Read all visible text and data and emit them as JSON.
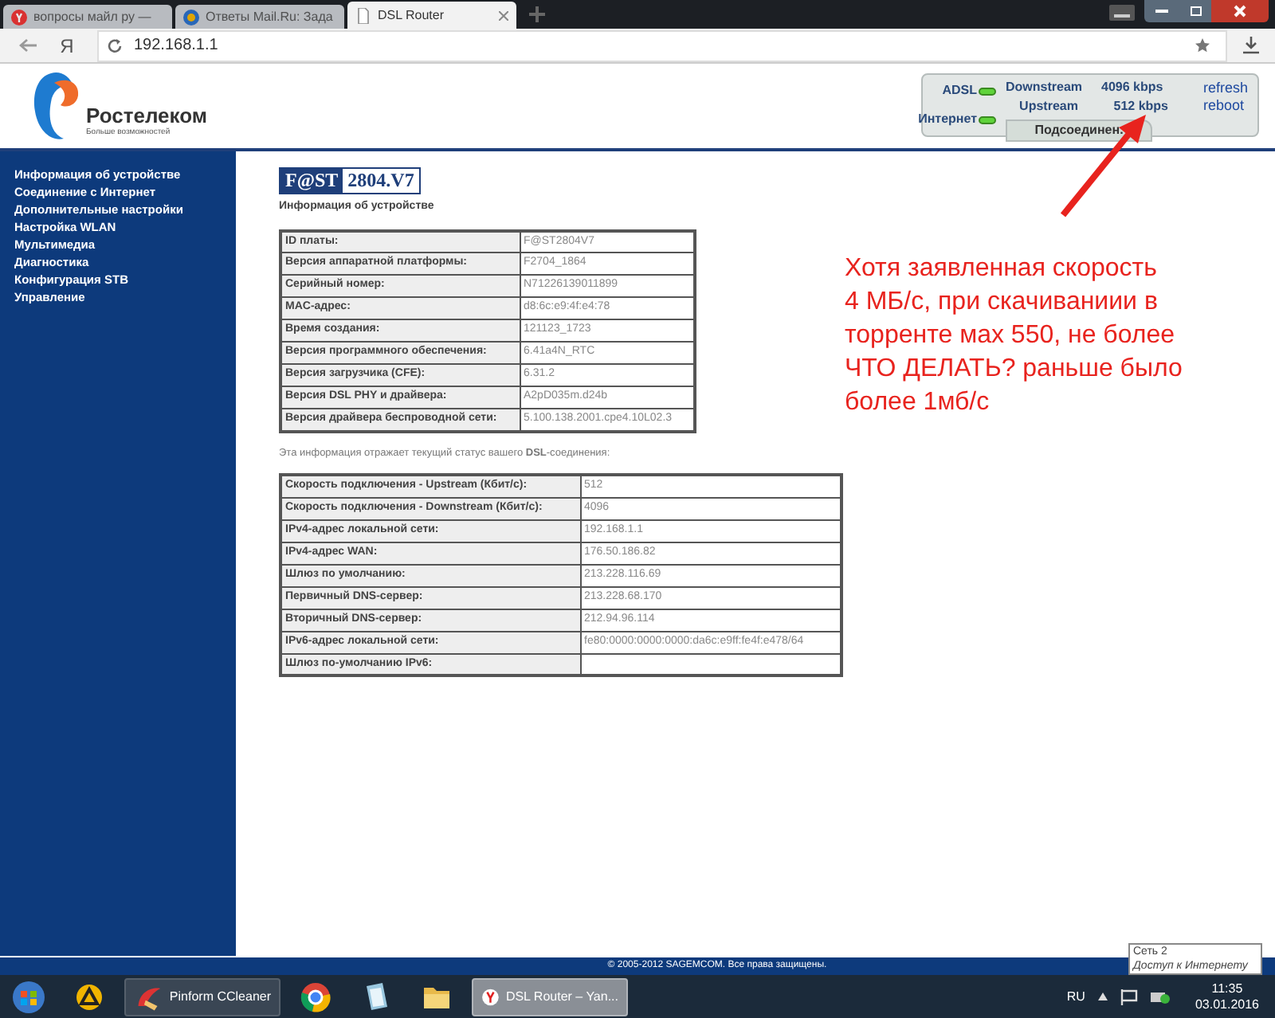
{
  "browser": {
    "tabs": [
      {
        "label": "вопросы майл ру —",
        "selected": false,
        "kind": "yandex"
      },
      {
        "label": "Ответы Mail.Ru: Зада",
        "selected": false,
        "kind": "mail"
      },
      {
        "label": "DSL Router",
        "selected": true,
        "kind": "page"
      }
    ],
    "address_bar": {
      "yandex_button": "Я",
      "url": "192.168.1.1"
    }
  },
  "header": {
    "logo": {
      "name": "Ростелеком",
      "slogan": "Больше возможностей"
    },
    "status": {
      "leds": [
        {
          "label": "ADSL",
          "on": true
        },
        {
          "label": "Интернет",
          "on": true
        }
      ],
      "downstream": {
        "label": "Downstream",
        "value": "4096 kbps"
      },
      "upstream": {
        "label": "Upstream",
        "value": "512 kbps"
      },
      "connection": "Подсоединен.",
      "links": [
        "refresh",
        "reboot"
      ]
    }
  },
  "sidebar": {
    "items": [
      "Информация об устройстве",
      "Соединение с Интернет",
      "Дополнительные настройки",
      "Настройка WLAN",
      "Мультимедиа",
      "Диагностика",
      "Конфигурация STB",
      "Управление"
    ]
  },
  "content": {
    "model": {
      "brand": "F@ST",
      "number": "2804.V7"
    },
    "subtitle": "Информация об устройстве",
    "device_table": [
      [
        "ID платы:",
        "F@ST2804V7"
      ],
      [
        "Версия аппаратной платформы:",
        "F2704_1864"
      ],
      [
        "Серийный номер:",
        "N71226139011899"
      ],
      [
        "MAC-адрес:",
        "d8:6c:e9:4f:e4:78"
      ],
      [
        "Время создания:",
        "121123_1723"
      ],
      [
        "Версия программного обеспечения:",
        "6.41a4N_RTC"
      ],
      [
        "Версия загрузчика (CFE):",
        "6.31.2"
      ],
      [
        "Версия DSL PHY и драйвера:",
        "A2pD035m.d24b"
      ],
      [
        "Версия драйвера беспроводной сети:",
        "5.100.138.2001.cpe4.10L02.3"
      ]
    ],
    "status_note": "Эта информация отражает текущий статус вашего **DSL**-соединения:",
    "status_table": [
      [
        "Скорость подключения - Upstream (Кбит/с):",
        "512"
      ],
      [
        "Скорость подключения - Downstream (Кбит/с):",
        "4096"
      ],
      [
        "IPv4-адрес локальной сети:",
        "192.168.1.1"
      ],
      [
        "IPv4-адрес WAN:",
        "176.50.186.82"
      ],
      [
        "Шлюз по умолчанию:",
        "213.228.116.69"
      ],
      [
        "Первичный DNS-сервер:",
        "213.228.68.170"
      ],
      [
        "Вторичный DNS-сервер:",
        "212.94.96.114"
      ],
      [
        "IPv6-адрес локальной сети:",
        "fe80:0000:0000:0000:da6c:e9ff:fe4f:e478/64"
      ],
      [
        "Шлюз по-умолчанию IPv6:"
      ]
    ]
  },
  "annotation": {
    "lines": [
      "Хотя заявленная скорость",
      "4 МБ/с, при скачиваниии в",
      "торренте мах 550, не более",
      "ЧТО ДЕЛАТЬ? раньше было",
      "более 1мб/с"
    ]
  },
  "footer": "© 2005-2012 SAGEMCOM. Все права защищены.",
  "tooltip": {
    "title": "Сеть 2",
    "text": "Доступ к Интернету"
  },
  "taskbar": {
    "items": [
      {
        "kind": "start",
        "selected": false
      },
      {
        "kind": "triangle",
        "selected": false
      },
      {
        "kind": "ccleaner",
        "label": "Pinform CCleaner",
        "selected": false
      },
      {
        "kind": "chrome",
        "selected": false
      },
      {
        "kind": "notepad",
        "selected": false
      },
      {
        "kind": "folder",
        "selected": false
      },
      {
        "kind": "yandex",
        "label": "DSL Router – Yan...",
        "selected": true
      }
    ],
    "language": "RU",
    "time": "11:35",
    "date": "03.01.2016"
  }
}
